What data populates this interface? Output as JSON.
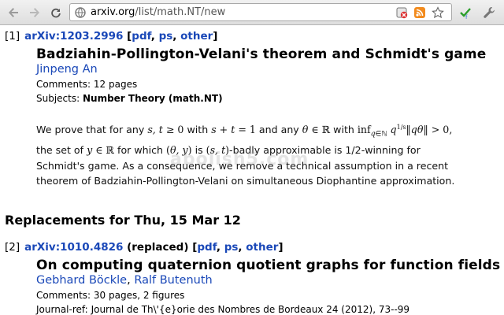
{
  "browser": {
    "url_host": "arxiv.org",
    "url_path": "/list/math.NT/new",
    "icons": [
      "back-arrow-icon",
      "forward-arrow-icon",
      "reload-icon",
      "page-icon",
      "translate-icon",
      "rss-icon",
      "bookmark-star-icon",
      "extension-check-icon",
      "wrench-menu-icon"
    ]
  },
  "entries": [
    {
      "num": "[1]",
      "id": "arXiv:1203.2996",
      "pdf": "pdf",
      "ps": "ps",
      "other": "other",
      "title": "Badziahin-Pollington-Velani's theorem and Schmidt's game",
      "authors": [
        "Jinpeng An"
      ],
      "comments_label": "Comments:",
      "comments": "12 pages",
      "subjects_label": "Subjects:",
      "subjects": "Number Theory (math.NT)",
      "abstract": {
        "l1a": "We prove that for any ",
        "l1b": " with ",
        "l1c": " and any ",
        "l1d": " with ",
        "l2a": "the set of ",
        "l2b": " for which ",
        "l2c": " is ",
        "l2d": "-badly approximable is 1/2-winning for",
        "l3": "Schmidt's game. As a consequence, we remove a technical assumption in a recent",
        "l4": "theorem of Badziahin-Pollington-Velani on simultaneous Diophantine approximation."
      }
    },
    {
      "num": "[2]",
      "id": "arXiv:1010.4826",
      "replaced": "(replaced)",
      "pdf": "pdf",
      "ps": "ps",
      "other": "other",
      "title": "On computing quaternion quotient graphs for function fields",
      "authors": [
        "Gebhard Böckle",
        "Ralf Butenuth"
      ],
      "comments_label": "Comments:",
      "comments": "30 pages, 2 figures",
      "journal_label": "Journal-ref:",
      "journal": "Journal de Th\\'{e}orie des Nombres de Bordeaux 24 (2012), 73--99"
    }
  ],
  "section_title": "Replacements for Thu, 15 Mar 12",
  "watermark": "abolish5.com"
}
